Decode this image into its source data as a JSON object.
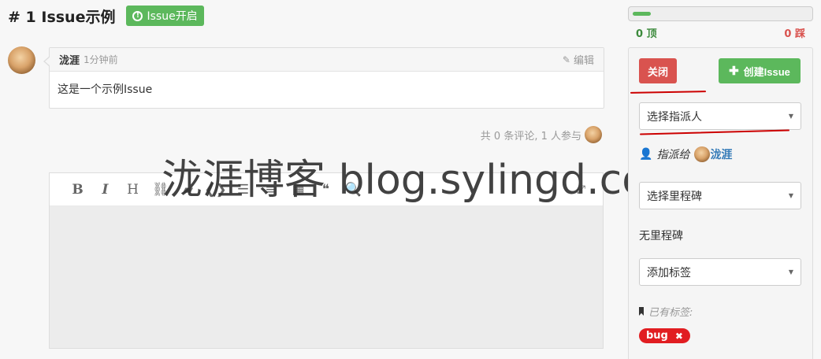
{
  "issue": {
    "title": "# 1 Issue示例",
    "state_label": "Issue开启",
    "state_color": "#5cb85c"
  },
  "comment": {
    "author": "泷涯",
    "time": "1分钟前",
    "edit_label": "编辑",
    "body": "这是一个示例Issue"
  },
  "participants_text": "共 0 条评论, 1 人参与",
  "editor": {
    "toolbar": [
      {
        "icon": "bold-icon",
        "glyph": "B"
      },
      {
        "icon": "italic-icon",
        "glyph": "I"
      },
      {
        "icon": "heading-icon",
        "glyph": "H"
      },
      {
        "icon": "link-icon",
        "glyph": "⛓"
      },
      {
        "icon": "image-icon",
        "glyph": "▰"
      },
      {
        "icon": "code-icon",
        "glyph": "❮❯"
      },
      {
        "icon": "list-ul-icon",
        "glyph": "☰"
      },
      {
        "icon": "list-ol-icon",
        "glyph": "≡"
      },
      {
        "icon": "table-icon",
        "glyph": "▦"
      },
      {
        "icon": "quote-icon",
        "glyph": "❝"
      },
      {
        "icon": "preview-icon",
        "glyph": "🔍"
      }
    ],
    "fullscreen_icon": "fullscreen-icon"
  },
  "watermark": "泷涯博客 blog.sylingd.com",
  "vote": {
    "up_label": "0 顶",
    "down_label": "0 踩",
    "up_fraction": 0.1
  },
  "sidebar": {
    "close_label": "关闭",
    "create_label": "创建Issue",
    "assignee_select": "选择指派人",
    "assigned_to_label": "指派给",
    "assignee_name": "泷涯",
    "milestone_select": "选择里程碑",
    "no_milestone": "无里程碑",
    "label_select": "添加标签",
    "labels_title": "已有标签:",
    "labels": [
      {
        "name": "bug",
        "color": "#e11d21"
      }
    ]
  },
  "colors": {
    "danger": "#d9534f",
    "success": "#5cb85c",
    "link": "#337ab7",
    "annotation": "#cc0000"
  }
}
